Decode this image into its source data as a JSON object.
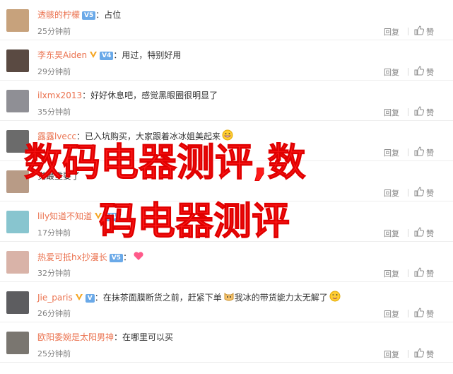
{
  "colors": {
    "username": "#eb7350",
    "meta": "#808080",
    "badge": "#6aa9e8",
    "watermark": "#ff1b1b"
  },
  "action_labels": {
    "reply": "回复",
    "like": "赞"
  },
  "comments": [
    {
      "user": "透骸的柠檬",
      "badge": "V5",
      "vip": "",
      "sep": "：",
      "text": "占位",
      "time": "25分钟前",
      "avatar_color": "#c7a27c"
    },
    {
      "user": "李东昊Aiden",
      "badge": "V4",
      "vip": "V",
      "sep": "：",
      "text": "用过，特别好用",
      "time": "29分钟前",
      "avatar_color": "#5a4a42"
    },
    {
      "user": "ilxmx2013",
      "badge": "",
      "vip": "",
      "sep": "：",
      "text": "好好休息吧，感觉黑眼圈很明显了",
      "time": "35分钟前",
      "avatar_color": "#8f8f95"
    },
    {
      "user": "露露lvecc",
      "badge": "",
      "vip": "",
      "sep": "：",
      "text": "已入坑购买，大家跟着冰冰姐美起来",
      "time": "",
      "avatar_color": "#6b6b6b",
      "emoji": "grin"
    },
    {
      "user": "",
      "badge": "",
      "vip": "",
      "sep": "",
      "text": "觉最重要了",
      "time": "",
      "avatar_color": "#b89b86"
    },
    {
      "user": "lily知道不知道",
      "badge": "V4",
      "vip": "V",
      "sep": "：",
      "text": "",
      "time": "17分钟前",
      "avatar_color": "#88c5cf"
    },
    {
      "user": "热爱可抵hx抄漫长",
      "badge": "V5",
      "vip": "",
      "sep": "：",
      "text": "",
      "time": "32分钟前",
      "avatar_color": "#d9b3a8",
      "emoji": "heart"
    },
    {
      "user": "Jie_paris",
      "badge": "V",
      "vip": "V",
      "sep": "：",
      "text": "在抹茶面膜断货之前，赶紧下单",
      "text2": "我冰的带货能力太无解了",
      "time": "26分钟前",
      "avatar_color": "#5d5d60",
      "emoji": "cat",
      "emoji2": "wink"
    },
    {
      "user": "欧阳委婉是太阳男神",
      "badge": "",
      "vip": "",
      "sep": "：",
      "text": "在哪里可以买",
      "time": "25分钟前",
      "avatar_color": "#7a7670"
    }
  ],
  "watermark": {
    "line1": "数码电器测评,数",
    "line2": "码电器测评"
  }
}
